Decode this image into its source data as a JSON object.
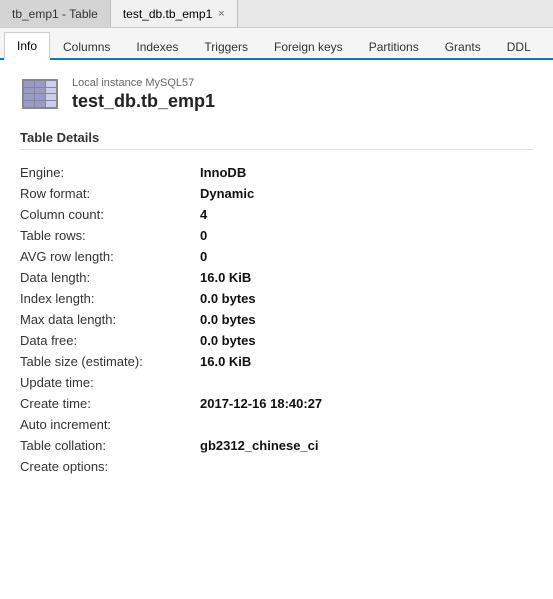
{
  "titleBar": {
    "tab1": "tb_emp1 - Table",
    "tab2": "test_db.tb_emp1",
    "tab2_close": "×"
  },
  "navTabs": {
    "tabs": [
      {
        "label": "Info",
        "active": true
      },
      {
        "label": "Columns",
        "active": false
      },
      {
        "label": "Indexes",
        "active": false
      },
      {
        "label": "Triggers",
        "active": false
      },
      {
        "label": "Foreign keys",
        "active": false
      },
      {
        "label": "Partitions",
        "active": false
      },
      {
        "label": "Grants",
        "active": false
      },
      {
        "label": "DDL",
        "active": false
      }
    ]
  },
  "header": {
    "instance_label": "Local instance MySQL57",
    "table_name": "test_db.tb_emp1"
  },
  "section_title": "Table Details",
  "details": [
    {
      "label": "Engine:",
      "value": "InnoDB"
    },
    {
      "label": "Row format:",
      "value": "Dynamic"
    },
    {
      "label": "Column count:",
      "value": "4"
    },
    {
      "label": "Table rows:",
      "value": "0"
    },
    {
      "label": "AVG row length:",
      "value": "0"
    },
    {
      "label": "Data length:",
      "value": "16.0 KiB"
    },
    {
      "label": "Index length:",
      "value": "0.0 bytes"
    },
    {
      "label": "Max data length:",
      "value": "0.0 bytes"
    },
    {
      "label": "Data free:",
      "value": "0.0 bytes"
    },
    {
      "label": "Table size (estimate):",
      "value": "16.0 KiB"
    },
    {
      "label": "Update time:",
      "value": ""
    },
    {
      "label": "Create time:",
      "value": "2017-12-16 18:40:27"
    },
    {
      "label": "Auto increment:",
      "value": ""
    },
    {
      "label": "Table collation:",
      "value": "gb2312_chinese_ci"
    },
    {
      "label": "Create options:",
      "value": ""
    }
  ]
}
